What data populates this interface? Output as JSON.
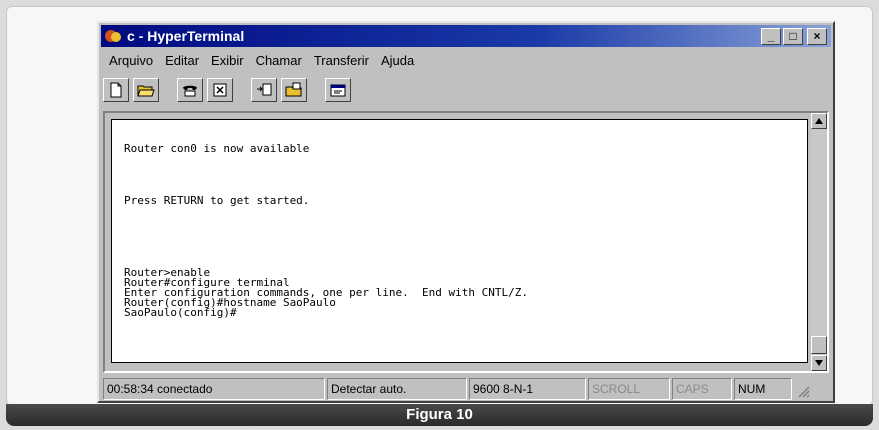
{
  "window": {
    "title": "c - HyperTerminal",
    "controls": {
      "minimize": "_",
      "maximize": "□",
      "close": "×"
    }
  },
  "menu": [
    "Arquivo",
    "Editar",
    "Exibir",
    "Chamar",
    "Transferir",
    "Ajuda"
  ],
  "toolbar": {
    "icons": [
      "new-document-icon",
      "open-folder-icon",
      "phone-call-icon",
      "disconnect-icon",
      "send-icon",
      "receive-icon",
      "properties-icon"
    ]
  },
  "terminal": {
    "lines": [
      "Router con0 is now available",
      "Press RETURN to get started.",
      "Router>enable",
      "Router#configure terminal",
      "Enter configuration commands, one per line.  End with CNTL/Z.",
      "Router(config)#hostname SaoPaulo",
      "SaoPaulo(config)#"
    ]
  },
  "status": {
    "time": "00:58:34 conectado",
    "detect": "Detectar auto.",
    "settings": "9600 8-N-1",
    "scroll": "SCROLL",
    "caps": "CAPS",
    "num": "NUM"
  },
  "caption": "Figura 10"
}
